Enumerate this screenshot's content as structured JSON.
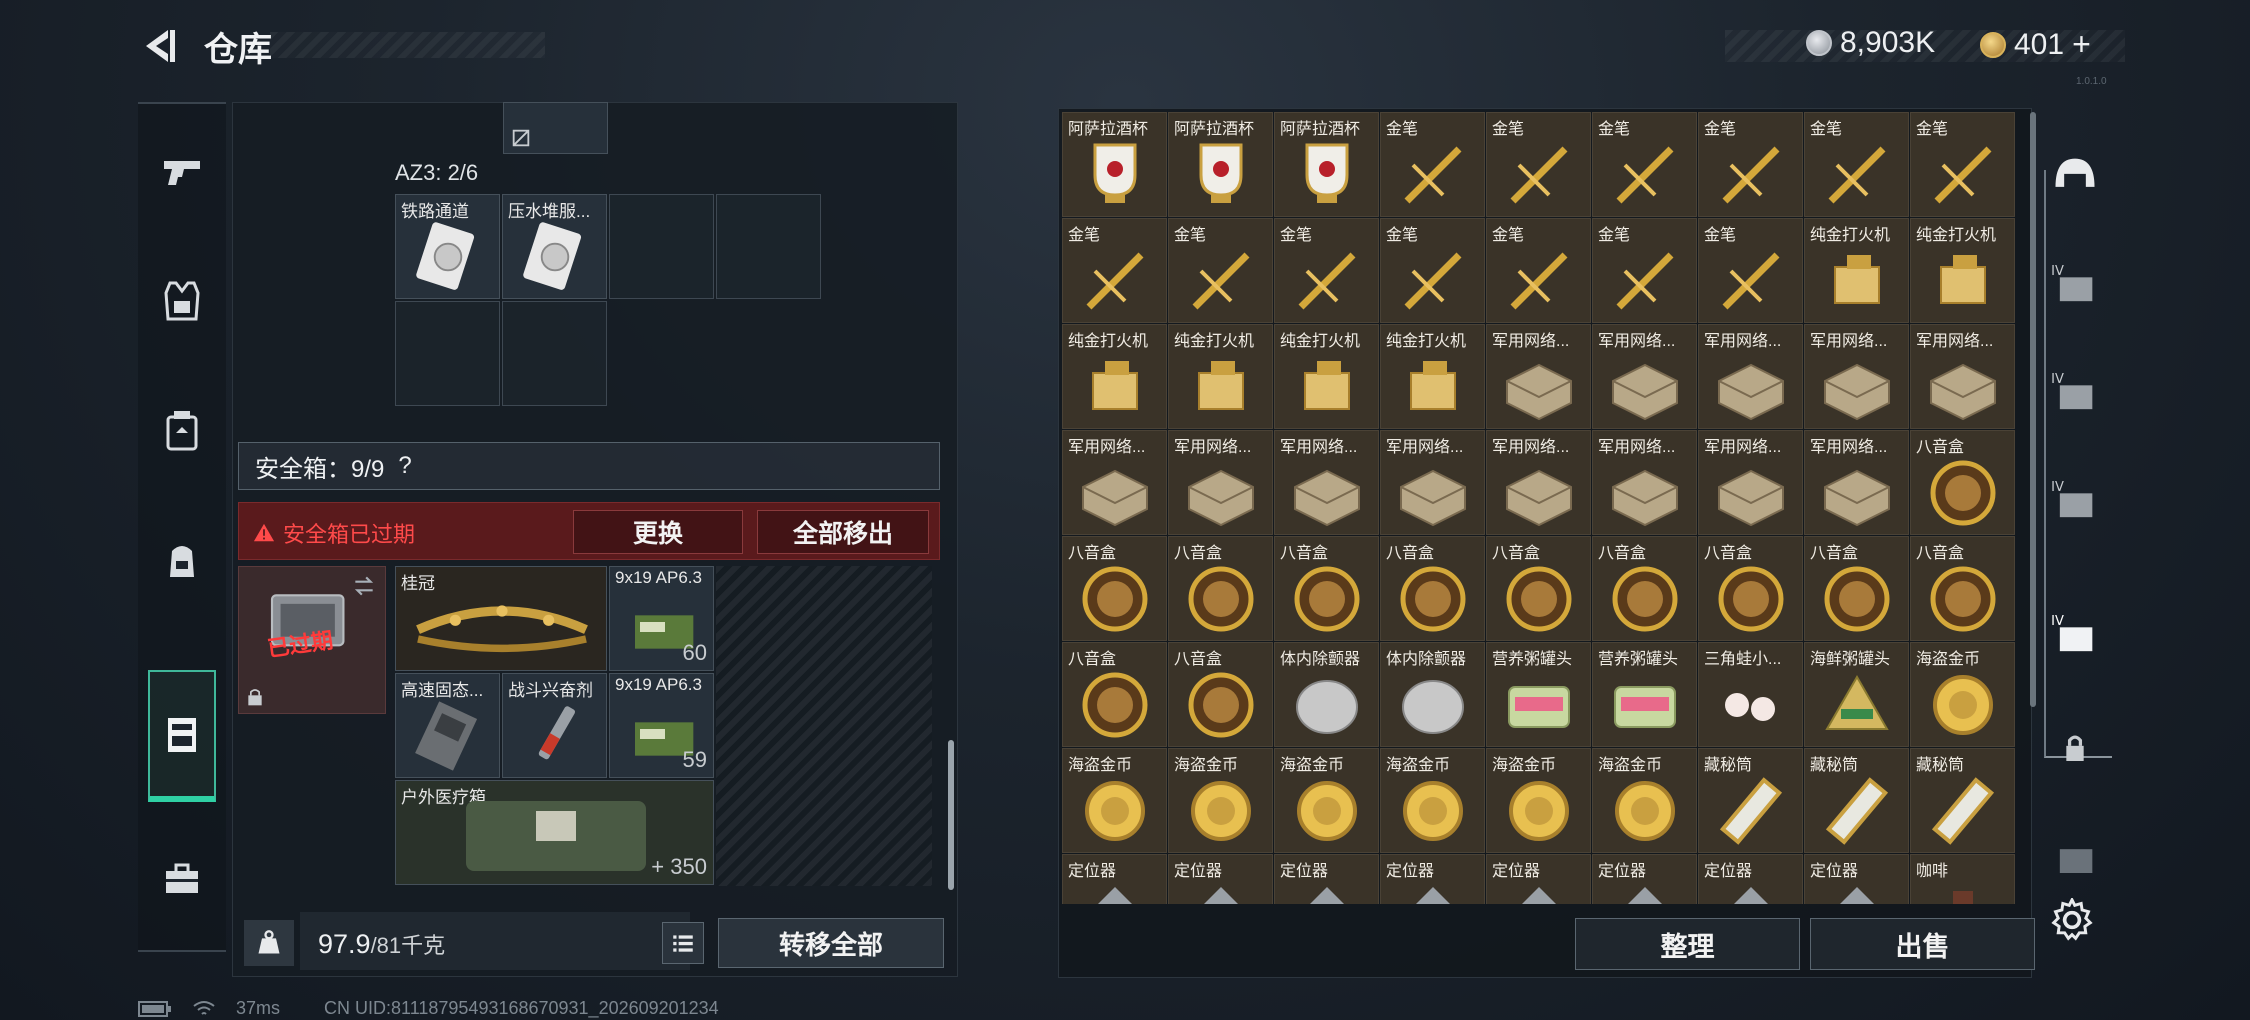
{
  "header": {
    "title": "仓库",
    "silver_amount": "8,903K",
    "gold_amount": "401",
    "gold_plus": "+",
    "version": "1.0.1.0"
  },
  "left_nav": {
    "items": [
      {
        "name": "nav-weapon",
        "icon": "pistol-icon"
      },
      {
        "name": "nav-armor",
        "icon": "armor-vest-icon"
      },
      {
        "name": "nav-chest-rig",
        "icon": "chest-rig-icon"
      },
      {
        "name": "nav-backpack",
        "icon": "backpack-icon"
      },
      {
        "name": "nav-safebox",
        "icon": "safebox-icon",
        "selected": true
      },
      {
        "name": "nav-case",
        "icon": "briefcase-icon"
      }
    ]
  },
  "container": {
    "az3_label": "AZ3: 2/6",
    "az3_items": [
      "铁路通道",
      "压水堆服..."
    ]
  },
  "safebox": {
    "header": "安全箱：9/9",
    "help": "?",
    "expired_text": "安全箱已过期",
    "replace_button": "更换",
    "move_all_button": "全部移出",
    "expired_stamp": "已过期",
    "items": [
      {
        "label": "桂冠",
        "count": ""
      },
      {
        "label": "9x19 AP6.3",
        "count": "60"
      },
      {
        "label": "高速固态...",
        "count": ""
      },
      {
        "label": "战斗兴奋剂",
        "count": ""
      },
      {
        "label": "9x19 AP6.3",
        "count": "59"
      },
      {
        "label": "户外医疗箱",
        "count": "350",
        "count_prefix": "+"
      }
    ]
  },
  "weight": {
    "current": "97.9",
    "max": "/81千克"
  },
  "buttons": {
    "transfer_all": "转移全部",
    "sort": "整理",
    "sell": "出售"
  },
  "status": {
    "ping": "37ms",
    "uid": "CN UID:81118795493168670931_202609201234"
  },
  "stash_grid": {
    "rows": [
      [
        "阿萨拉酒杯",
        "阿萨拉酒杯",
        "阿萨拉酒杯",
        "金笔",
        "金笔",
        "金笔",
        "金笔",
        "金笔",
        "金笔"
      ],
      [
        "金笔",
        "金笔",
        "金笔",
        "金笔",
        "金笔",
        "金笔",
        "金笔",
        "纯金打火机",
        "纯金打火机"
      ],
      [
        "纯金打火机",
        "纯金打火机",
        "纯金打火机",
        "纯金打火机",
        "军用网络...",
        "军用网络...",
        "军用网络...",
        "军用网络...",
        "军用网络..."
      ],
      [
        "军用网络...",
        "军用网络...",
        "军用网络...",
        "军用网络...",
        "军用网络...",
        "军用网络...",
        "军用网络...",
        "军用网络...",
        "八音盒"
      ],
      [
        "八音盒",
        "八音盒",
        "八音盒",
        "八音盒",
        "八音盒",
        "八音盒",
        "八音盒",
        "八音盒",
        "八音盒"
      ],
      [
        "八音盒",
        "八音盒",
        "体内除颤器",
        "体内除颤器",
        "营养粥罐头",
        "营养粥罐头",
        "三角蛙小...",
        "海鲜粥罐头",
        "海盗金币"
      ],
      [
        "海盗金币",
        "海盗金币",
        "海盗金币",
        "海盗金币",
        "海盗金币",
        "海盗金币",
        "藏秘筒",
        "藏秘筒",
        "藏秘筒"
      ],
      [
        "定位器",
        "定位器",
        "定位器",
        "定位器",
        "定位器",
        "定位器",
        "定位器",
        "定位器",
        "咖啡"
      ]
    ],
    "cell_color": "#3a3328"
  },
  "right_nav": {
    "items": [
      "helmet-icon",
      "container-iv-icon",
      "container-iv-icon",
      "container-iv-icon",
      "container-iv-icon",
      "lock-icon",
      "container-icon"
    ],
    "settings_icon": "gear-icon"
  },
  "colors": {
    "accent_green": "#2fd0a4",
    "expired_red": "#ff4a4a",
    "gold": "#d4a83a"
  }
}
